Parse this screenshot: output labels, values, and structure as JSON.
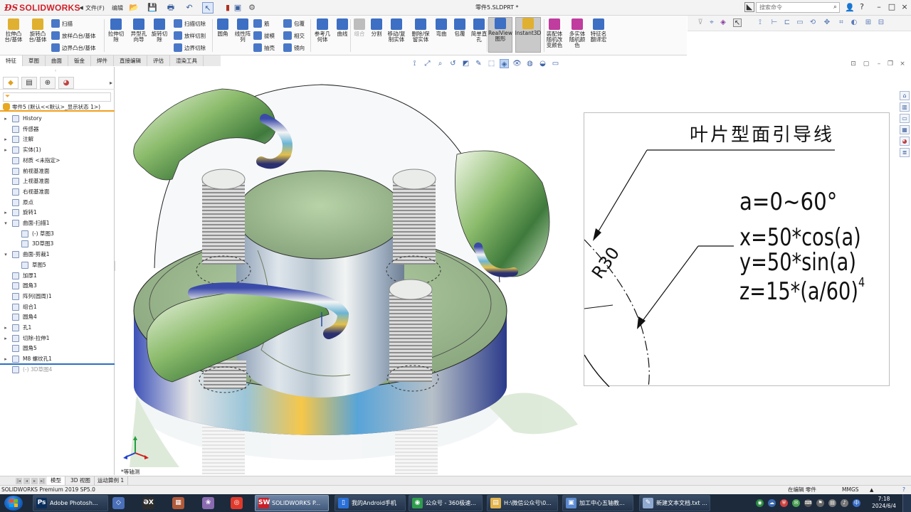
{
  "app": {
    "brand": "SOLIDWORKS",
    "document_title": "零件5.SLDPRT *",
    "menu_file": "文件(F)",
    "menu_edit": "编辑",
    "search_placeholder": "搜索命令",
    "window_controls": [
      "?",
      "–",
      "□",
      "×"
    ]
  },
  "command_manager": {
    "large_buttons": [
      {
        "id": "extrude-boss",
        "label": "拉伸凸\n台/基体",
        "color": "#e0b030"
      },
      {
        "id": "revolve-boss",
        "label": "旋转凸\n台/基体",
        "color": "#e0b030"
      },
      {
        "id": "extrude-cut",
        "label": "拉伸切\n除",
        "color": "#3d6fc4"
      },
      {
        "id": "hole-wizard",
        "label": "异型孔\n向导",
        "color": "#3d6fc4"
      },
      {
        "id": "revolve-cut",
        "label": "旋转切\n除",
        "color": "#3d6fc4"
      },
      {
        "id": "fillet",
        "label": "圆角",
        "color": "#3d6fc4"
      },
      {
        "id": "linear-pattern",
        "label": "线性阵\n列",
        "color": "#3d6fc4"
      },
      {
        "id": "ref-geometry",
        "label": "参考几\n何体",
        "color": "#3d6fc4"
      },
      {
        "id": "curves",
        "label": "曲线",
        "color": "#3d6fc4"
      },
      {
        "id": "combine",
        "label": "组合",
        "color": "#bdbdbd",
        "disabled": true
      },
      {
        "id": "split",
        "label": "分割",
        "color": "#3d6fc4"
      },
      {
        "id": "move-copy",
        "label": "移动/复\n制实体",
        "color": "#3d6fc4"
      },
      {
        "id": "delete-keep",
        "label": "删除/保\n留实体",
        "color": "#3d6fc4"
      },
      {
        "id": "flex",
        "label": "弯曲",
        "color": "#3d6fc4"
      },
      {
        "id": "wrap",
        "label": "包覆",
        "color": "#3d6fc4"
      },
      {
        "id": "simple-hole",
        "label": "简单直\n孔",
        "color": "#3d6fc4"
      },
      {
        "id": "realview",
        "label": "RealView\n图形",
        "color": "#3d6fc4",
        "active": true
      },
      {
        "id": "instant3d",
        "label": "Instant3D",
        "color": "#e0b030",
        "active": true
      },
      {
        "id": "assembly-color",
        "label": "装配体\n随机改\n变颜色",
        "color": "#c03c9e"
      },
      {
        "id": "multibody-color",
        "label": "多实体\n随机颜\n色",
        "color": "#c03c9e"
      },
      {
        "id": "feature-rename",
        "label": "特征名\n翻译宏",
        "color": "#3d6fc4"
      }
    ],
    "small_buttons": [
      {
        "id": "sweep",
        "label": "扫描"
      },
      {
        "id": "loft",
        "label": "放样凸台/基体"
      },
      {
        "id": "boundary",
        "label": "边界凸台/基体"
      },
      {
        "id": "swept-cut",
        "label": "扫描切除"
      },
      {
        "id": "lofted-cut",
        "label": "放样切割"
      },
      {
        "id": "boundary-cut",
        "label": "边界切除"
      },
      {
        "id": "rib",
        "label": "筋"
      },
      {
        "id": "draft",
        "label": "拔模"
      },
      {
        "id": "shell",
        "label": "抽壳"
      },
      {
        "id": "wrap2",
        "label": "包覆"
      },
      {
        "id": "intersect",
        "label": "相交"
      },
      {
        "id": "mirror",
        "label": "镜向"
      }
    ]
  },
  "tabs": [
    "特征",
    "草图",
    "曲面",
    "钣金",
    "焊件",
    "直接编辑",
    "评估",
    "渲染工具"
  ],
  "active_tab": "特征",
  "feature_tree": {
    "root": "零件5  (默认<<默认>_显示状态 1>)",
    "items": [
      {
        "label": "History",
        "indent": 0,
        "expand": "▸"
      },
      {
        "label": "传感器",
        "indent": 0,
        "expand": ""
      },
      {
        "label": "注解",
        "indent": 0,
        "expand": "▸"
      },
      {
        "label": "实体(1)",
        "indent": 0,
        "expand": "▸"
      },
      {
        "label": "材质 <未指定>",
        "indent": 0,
        "expand": ""
      },
      {
        "label": "前视基准面",
        "indent": 0,
        "expand": ""
      },
      {
        "label": "上视基准面",
        "indent": 0,
        "expand": ""
      },
      {
        "label": "右视基准面",
        "indent": 0,
        "expand": ""
      },
      {
        "label": "原点",
        "indent": 0,
        "expand": ""
      },
      {
        "label": "旋转1",
        "indent": 0,
        "expand": "▸"
      },
      {
        "label": "曲面-扫描1",
        "indent": 0,
        "expand": "▾"
      },
      {
        "label": "(-) 草图3",
        "indent": 1,
        "expand": ""
      },
      {
        "label": "3D草图3",
        "indent": 1,
        "expand": ""
      },
      {
        "label": "曲面-剪裁1",
        "indent": 0,
        "expand": "▾"
      },
      {
        "label": "草图5",
        "indent": 1,
        "expand": ""
      },
      {
        "label": "加厚1",
        "indent": 0,
        "expand": ""
      },
      {
        "label": "圆角3",
        "indent": 0,
        "expand": ""
      },
      {
        "label": "阵列(圆周)1",
        "indent": 0,
        "expand": ""
      },
      {
        "label": "组合1",
        "indent": 0,
        "expand": ""
      },
      {
        "label": "圆角4",
        "indent": 0,
        "expand": ""
      },
      {
        "label": "孔1",
        "indent": 0,
        "expand": "▸"
      },
      {
        "label": "切除-拉伸1",
        "indent": 0,
        "expand": "▸"
      },
      {
        "label": "圆角5",
        "indent": 0,
        "expand": ""
      },
      {
        "label": "M8 螺纹孔1",
        "indent": 0,
        "expand": "▸"
      },
      {
        "label": "(-) 3D草图4",
        "indent": 0,
        "expand": "",
        "dim": true
      }
    ]
  },
  "viewport": {
    "view_label": "*等轴测"
  },
  "drawing": {
    "title": "叶片型面引导线",
    "eq_a": "a=0~60°",
    "eq_x": "x=50*cos(a)",
    "eq_y": "y=50*sin(a)",
    "eq_z": "z=15*(a/60)",
    "eq_z_exp": "4",
    "radius": "R30"
  },
  "model_tabs": [
    "模型",
    "3D 视图",
    "运动算例 1"
  ],
  "status_bar": {
    "product": "SOLIDWORKS Premium 2019 SP5.0",
    "mode": "在编辑 零件",
    "units": "MMGS",
    "caret": "▲",
    "help": "?"
  },
  "taskbar": {
    "tasks": [
      {
        "label": "Adobe Photosh...",
        "color": "#0a2e5c",
        "letter": "Ps"
      },
      {
        "label": "SOLIDWORKS P...",
        "color": "#c8202a",
        "letter": "SW",
        "active": true
      },
      {
        "label": "我的Android手机",
        "color": "#2a70d8",
        "letter": "▯"
      },
      {
        "label": "公众号 - 360极速...",
        "color": "#2e9c4c",
        "letter": "◉"
      },
      {
        "label": "H:\\微信公众号\\0...",
        "color": "#e3b34a",
        "letter": "▤"
      },
      {
        "label": "加工中心五轴教...",
        "color": "#5a8ad0",
        "letter": "▣"
      },
      {
        "label": "新建文本文档.txt ...",
        "color": "#8fa9cf",
        "letter": "✎"
      }
    ],
    "pins": [
      {
        "color": "#4a6fb8",
        "letter": "◇"
      },
      {
        "color": "#2c2c2c",
        "letter": "ƏX"
      },
      {
        "color": "#b05a3a",
        "letter": "▦"
      },
      {
        "color": "#8a6bb0",
        "letter": "❀"
      },
      {
        "color": "#e0392a",
        "letter": "◎"
      }
    ],
    "clock_time": "7:18",
    "clock_date": "2024/6/4"
  }
}
